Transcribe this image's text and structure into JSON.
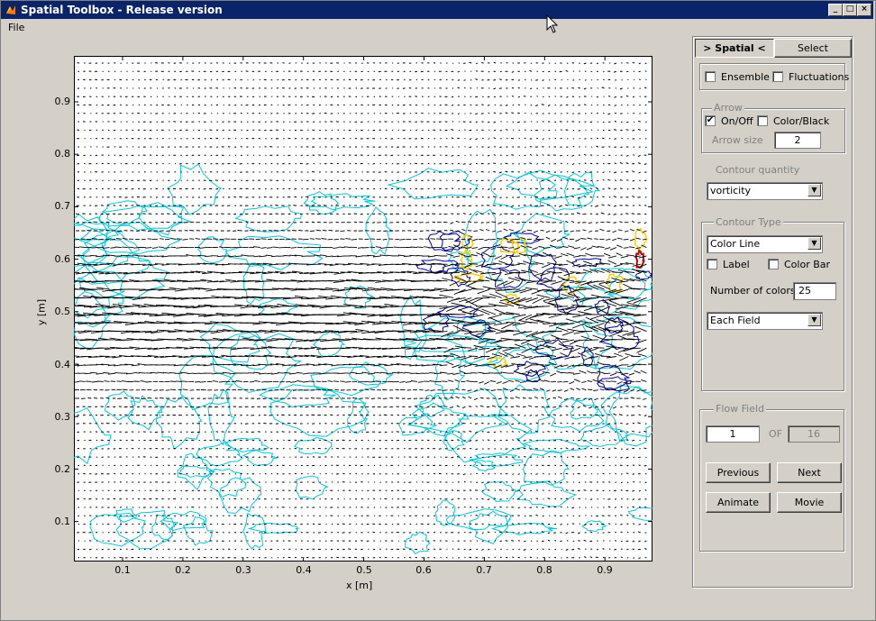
{
  "window": {
    "title": "Spatial Toolbox - Release version",
    "minimize": "_",
    "maximize": "□",
    "close": "×"
  },
  "menu": {
    "file": "File"
  },
  "tabs": {
    "spatial": "> Spatial <",
    "select": "Select"
  },
  "options": {
    "ensemble": "Ensemble",
    "fluctuations": "Fluctuations"
  },
  "arrow": {
    "group_label": "Arrow",
    "on_off": "On/Off",
    "on_off_checked": true,
    "color_black": "Color/Black",
    "size_label": "Arrow size",
    "size_value": "2"
  },
  "contour_quantity": {
    "label": "Contour quantity",
    "value": "vorticity"
  },
  "contour_type": {
    "group_label": "Contour Type",
    "type_value": "Color Line",
    "label": "Label",
    "color_bar": "Color Bar",
    "num_colors_label": "Number of colors",
    "num_colors_value": "25",
    "scope_value": "Each Field"
  },
  "flow_field": {
    "group_label": "Flow Field",
    "current": "1",
    "of_label": "OF",
    "total": "16",
    "previous": "Previous",
    "next": "Next",
    "animate": "Animate",
    "movie": "Movie"
  },
  "plot": {
    "xlabel": "x [m]",
    "ylabel": "y [m]",
    "xticks": [
      "0.1",
      "0.2",
      "0.3",
      "0.4",
      "0.5",
      "0.6",
      "0.7",
      "0.8",
      "0.9"
    ],
    "yticks": [
      "0.9",
      "0.8",
      "0.7",
      "0.6",
      "0.5",
      "0.4",
      "0.3",
      "0.2",
      "0.1"
    ],
    "colors": {
      "contour_low": "#00c8dc",
      "contour_mid": "#0000a0",
      "contour_high": "#ffd000",
      "contour_peak": "#c00000",
      "arrow": "#000000"
    }
  }
}
